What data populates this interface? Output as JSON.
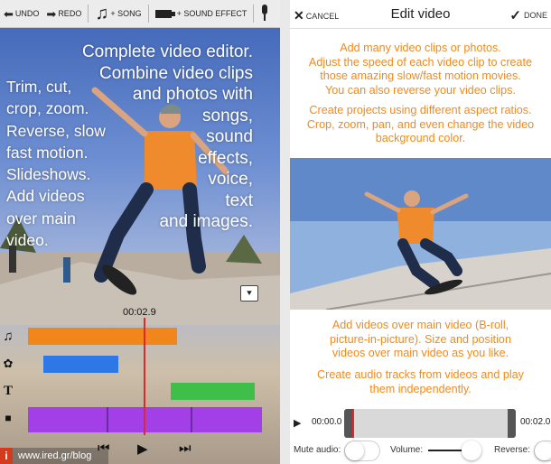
{
  "left": {
    "toolbar": {
      "undo_label": "UNDO",
      "redo_label": "REDO",
      "song_label": "+ SONG",
      "sound_effect_label": "+ SOUND EFFECT"
    },
    "promo_right": [
      "Complete video editor.",
      "Combine video clips",
      "and photos with",
      "songs,",
      "sound",
      "effects,",
      "voice,",
      "text",
      "and images."
    ],
    "promo_left": [
      "Trim, cut,",
      "crop, zoom.",
      "Reverse, slow",
      "fast motion.",
      "Slideshows.",
      "Add videos",
      "over main",
      "video."
    ],
    "timecode": "00:02.9",
    "watermark": {
      "badge": "i",
      "text": "www.ired.gr/blog"
    },
    "icons": {
      "undo": "undo-arrow-icon",
      "redo": "redo-arrow-icon",
      "song": "music-note-icon",
      "effect": "sound-effect-icon",
      "mic": "microphone-icon"
    }
  },
  "right": {
    "header": {
      "cancel_label": "CANCEL",
      "title": "Edit video",
      "done_label": "DONE"
    },
    "para1": [
      "Add many video clips or photos.",
      "Adjust the speed of each video clip to create",
      "those amazing slow/fast motion movies.",
      "You can also reverse your video clips."
    ],
    "para2": [
      "Create projects using different aspect ratios.",
      "Crop, zoom, pan, and even change the video",
      "background color."
    ],
    "para3": [
      "Add videos over main video (B-roll,",
      "picture-in-picture). Size and position",
      "videos over main video as you like."
    ],
    "para4": [
      "Create audio tracks from videos and play",
      "them independently."
    ],
    "player": {
      "start_time": "00:00.0",
      "end_time": "00:02.0"
    },
    "controls": {
      "mute_label": "Mute audio:",
      "volume_label": "Volume:",
      "reverse_label": "Reverse:",
      "volume_level": 0.8
    }
  },
  "colors": {
    "accent_orange": "#f08a1c",
    "song_clip": "#f1861d",
    "effect_clip": "#2e77e6",
    "text_clip": "#3fbf49",
    "video_clip": "#a23fe6",
    "playhead": "#e0282c"
  }
}
